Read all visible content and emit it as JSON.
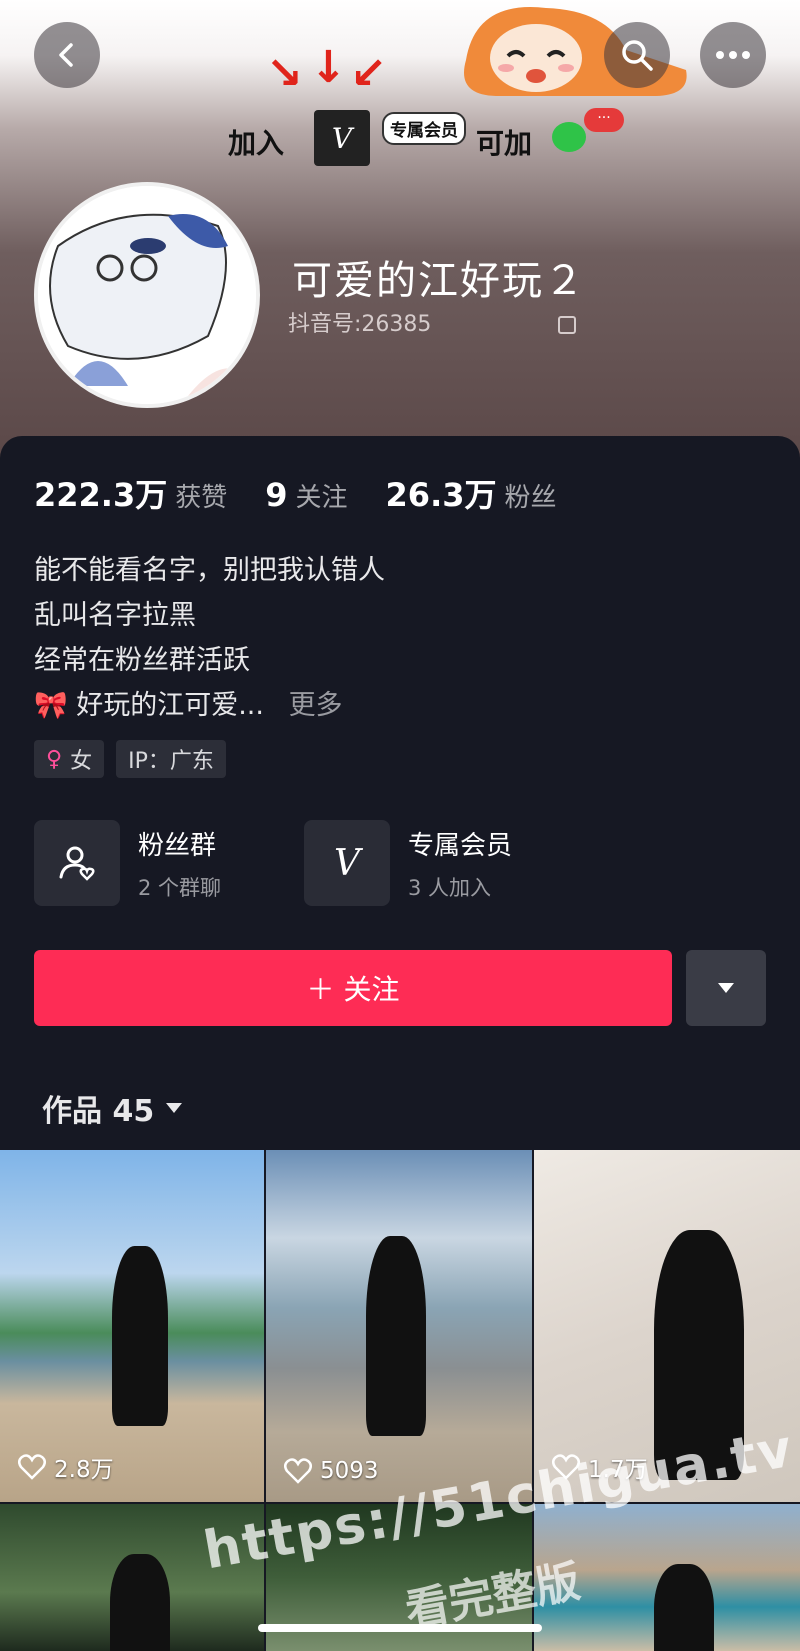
{
  "header": {
    "banner": {
      "join": "加入",
      "member": "专属会员",
      "can_add": "可加",
      "bubble": "···",
      "vip_glyph": "V"
    },
    "nickname": "可爱的江好玩２",
    "douyin_id_label": "抖音号:26385"
  },
  "stats": [
    {
      "value": "222.3万",
      "label": "获赞"
    },
    {
      "value": "9",
      "label": "关注"
    },
    {
      "value": "26.3万",
      "label": "粉丝"
    }
  ],
  "bio": {
    "lines": [
      "能不能看名字，别把我认错人",
      "乱叫名字拉黑",
      "经常在粉丝群活跃"
    ],
    "last_line": "好玩的江可爱...",
    "more": "更多"
  },
  "tags": {
    "gender": "女",
    "ip": "IP：广东"
  },
  "features": {
    "fan_group": {
      "title": "粉丝群",
      "sub": "2 个群聊"
    },
    "membership": {
      "title": "专属会员",
      "sub": "3 人加入"
    }
  },
  "actions": {
    "follow": "＋ 关注"
  },
  "works": {
    "tab_label": "作品 45"
  },
  "videos": [
    {
      "likes": "2.8万"
    },
    {
      "likes": "5093"
    },
    {
      "likes": "1.7万"
    }
  ],
  "watermark": {
    "line1": "https://51chigua.tv",
    "line2": "看完整版"
  },
  "colors": {
    "accent": "#fe2c55",
    "panel": "#161823"
  }
}
